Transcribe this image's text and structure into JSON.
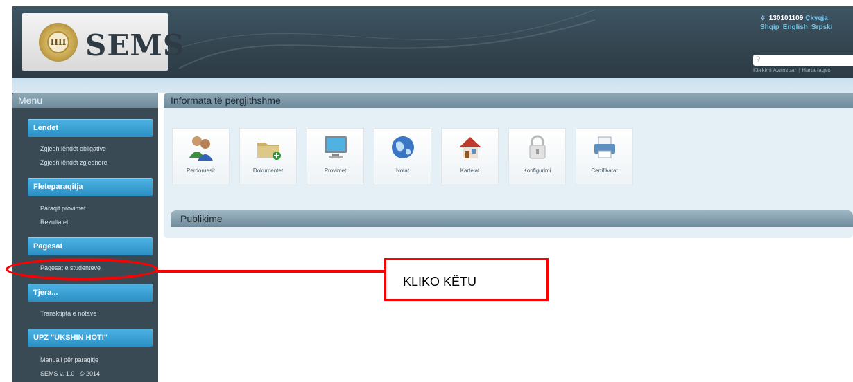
{
  "header": {
    "logo_text": "SEMS",
    "user_id": "130101109",
    "logout_label": "Çkyqja",
    "languages": [
      "Shqip",
      "English",
      "Srpski"
    ],
    "search_placeholder": "",
    "advanced_search": "Kërkimi Avansuar",
    "sitemap": "Harta faqes"
  },
  "sidebar": {
    "title": "Menu",
    "sections": [
      {
        "label": "Lendet",
        "items": [
          "Zgjedh lëndët obligative",
          "Zgjedh lëndët zgjedhore"
        ]
      },
      {
        "label": "Fleteparaqitja",
        "items": [
          "Paraqit provimet",
          "Rezultatet"
        ]
      },
      {
        "label": "Pagesat",
        "items": [
          "Pagesat e studenteve"
        ]
      },
      {
        "label": "Tjera...",
        "items": [
          "Transktipta e notave"
        ]
      },
      {
        "label": "UPZ \"UKSHIN HOTI\"",
        "items": [
          "Manuali për paraqitje",
          "SEMS v. 1.0   © 2014"
        ]
      }
    ]
  },
  "main": {
    "title": "Informata të përgjithshme",
    "tiles": [
      {
        "label": "Perdoruesit",
        "icon": "users-icon"
      },
      {
        "label": "Dokumentet",
        "icon": "folder-add-icon"
      },
      {
        "label": "Provimet",
        "icon": "monitor-icon"
      },
      {
        "label": "Notat",
        "icon": "globe-icon"
      },
      {
        "label": "Kartelat",
        "icon": "home-icon"
      },
      {
        "label": "Konfigurimi",
        "icon": "lock-icon"
      },
      {
        "label": "Certifikatat",
        "icon": "printer-icon"
      }
    ],
    "publications_title": "Publikime"
  },
  "annotation": {
    "callout_text": "KLIKO KËTU",
    "color": "#ff0000"
  },
  "colors": {
    "header_bg": "#33444f",
    "sidebar_bg": "#3a4a55",
    "section_button": "#2c8fc4",
    "main_bg": "#e4eff6"
  }
}
